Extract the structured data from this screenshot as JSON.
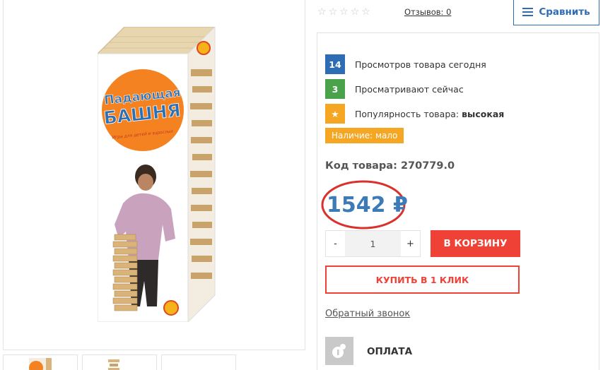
{
  "product": {
    "box_title_line1": "Падающая",
    "box_title_line2": "БАШНЯ",
    "box_subtitle": "Игра для детей и взрослых"
  },
  "rating": {
    "stars_total": 5,
    "stars_filled": 0,
    "reviews_label": "Отзывов:",
    "reviews_count": "0"
  },
  "compare": {
    "label": "Сравнить",
    "icon": "hamburger-icon"
  },
  "stats": [
    {
      "badge": "14",
      "text": "Просмотров товара сегодня",
      "color": "#2e6db4"
    },
    {
      "badge": "3",
      "text": "Просматривают сейчас",
      "color": "#4aa24a"
    },
    {
      "badge": "★",
      "text": "Популярность товара:",
      "value": "высокая",
      "color": "#f5a623"
    }
  ],
  "availability": "Наличие: мало",
  "sku": {
    "label": "Код товара:",
    "value": "270779.0"
  },
  "price": "1542 ₽",
  "quantity": {
    "minus": "-",
    "value": "1",
    "plus": "+"
  },
  "buttons": {
    "cart": "В КОРЗИНУ",
    "one_click": "КУПИТЬ В 1 КЛИК",
    "callback": "Обратный звонок",
    "payment": "ОПЛАТА"
  },
  "colors": {
    "accent_red": "#ef4136",
    "accent_blue": "#2e6db4",
    "price_blue": "#3d7ab8",
    "badge_green": "#4aa24a",
    "badge_orange": "#f5a623"
  }
}
